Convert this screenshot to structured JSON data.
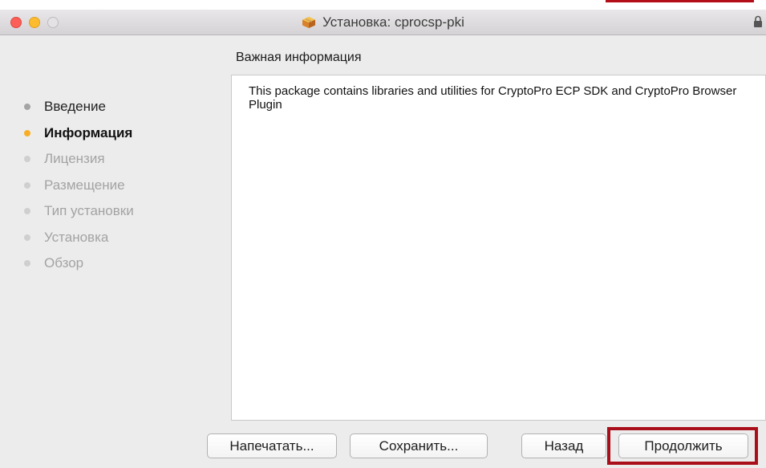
{
  "window": {
    "title": "Установка: cprocsp-pki",
    "title_icon": "package-icon",
    "lock_icon": "lock-icon"
  },
  "sidebar": {
    "steps": [
      {
        "label": "Введение",
        "state": "done"
      },
      {
        "label": "Информация",
        "state": "active"
      },
      {
        "label": "Лицензия",
        "state": "pending"
      },
      {
        "label": "Размещение",
        "state": "pending"
      },
      {
        "label": "Тип установки",
        "state": "pending"
      },
      {
        "label": "Установка",
        "state": "pending"
      },
      {
        "label": "Обзор",
        "state": "pending"
      }
    ]
  },
  "main": {
    "heading": "Важная информация",
    "content": "This package contains libraries and utilities for CryptoPro ECP SDK and CryptoPro Browser Plugin"
  },
  "buttons": {
    "print": "Напечатать...",
    "save": "Сохранить...",
    "back": "Назад",
    "continue": "Продолжить"
  },
  "colors": {
    "active_step": "#f8ae24",
    "highlight": "#a90f1b",
    "close": "#fc5f57",
    "minimize": "#fdbc2e"
  }
}
